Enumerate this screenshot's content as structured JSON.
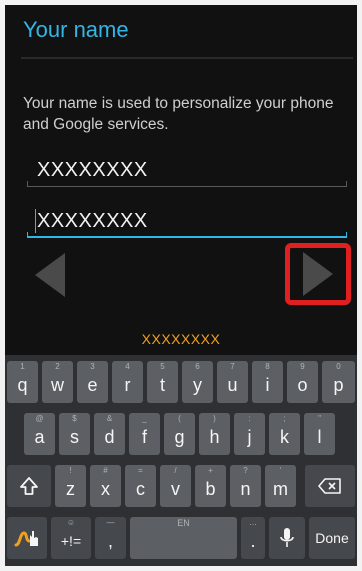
{
  "screen": {
    "title": "Your name",
    "description": "Your name is used to personalize your phone and Google services.",
    "first_name": "XXXXXXXX",
    "last_name": "XXXXXXXX",
    "user_hint": "XXXXXXXX"
  },
  "nav": {
    "prev_icon": "triangle-left-icon",
    "next_icon": "triangle-right-icon",
    "highlight_color": "#e02020"
  },
  "keyboard": {
    "row1": [
      {
        "main": "q",
        "sec": "1"
      },
      {
        "main": "w",
        "sec": "2"
      },
      {
        "main": "e",
        "sec": "3"
      },
      {
        "main": "r",
        "sec": "4"
      },
      {
        "main": "t",
        "sec": "5"
      },
      {
        "main": "y",
        "sec": "6"
      },
      {
        "main": "u",
        "sec": "7"
      },
      {
        "main": "i",
        "sec": "8"
      },
      {
        "main": "o",
        "sec": "9"
      },
      {
        "main": "p",
        "sec": "0"
      }
    ],
    "row2": [
      {
        "main": "a",
        "sec": "@"
      },
      {
        "main": "s",
        "sec": "$"
      },
      {
        "main": "d",
        "sec": "&"
      },
      {
        "main": "f",
        "sec": "_"
      },
      {
        "main": "g",
        "sec": "("
      },
      {
        "main": "h",
        "sec": ")"
      },
      {
        "main": "j",
        "sec": ":"
      },
      {
        "main": "k",
        "sec": ";"
      },
      {
        "main": "l",
        "sec": "\""
      }
    ],
    "row3": [
      {
        "main": "z",
        "sec": "!"
      },
      {
        "main": "x",
        "sec": "#"
      },
      {
        "main": "c",
        "sec": "="
      },
      {
        "main": "v",
        "sec": "/"
      },
      {
        "main": "b",
        "sec": "+"
      },
      {
        "main": "n",
        "sec": "?"
      },
      {
        "main": "m",
        "sec": "'"
      }
    ],
    "symbols_label": "+!=",
    "symbols_sec": "☺",
    "comma_label": ",",
    "space_label": "EN",
    "period_label": ".",
    "done_label": "Done",
    "shift_icon": "shift-icon",
    "backspace_icon": "backspace-icon",
    "swype_icon": "swype-icon",
    "mic_icon": "microphone-icon"
  },
  "colors": {
    "accent": "#33b5e5",
    "hint": "#f0a020"
  }
}
